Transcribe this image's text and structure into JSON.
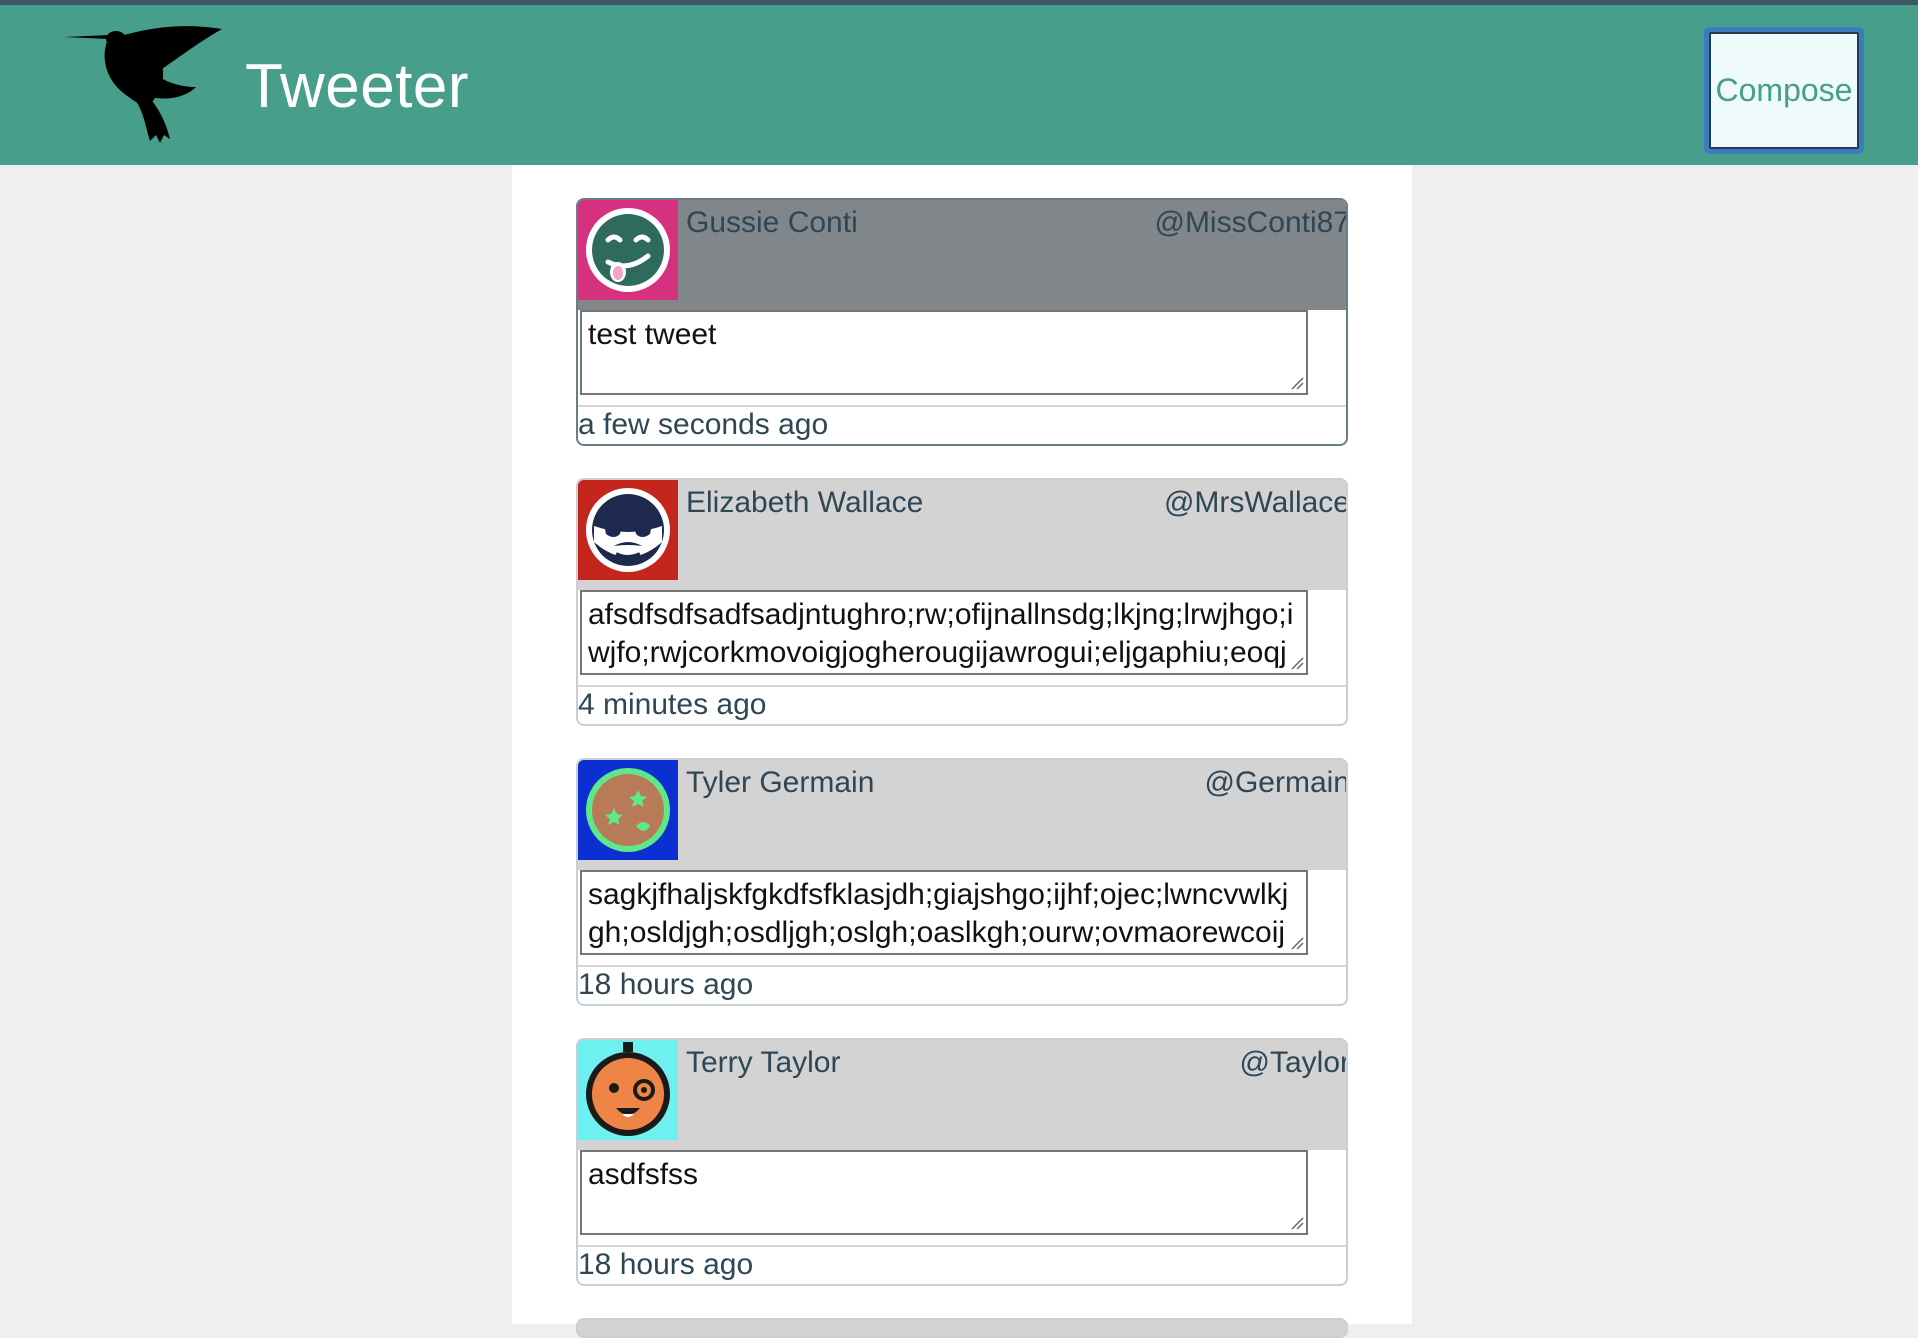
{
  "app": {
    "title": "Tweeter",
    "compose_label": "Compose",
    "colors": {
      "header": "#479e8a",
      "compose_text": "#479e8a",
      "compose_bg": "#effafa"
    }
  },
  "tweets": [
    {
      "name": "Gussie Conti",
      "handle": "@MissConti87",
      "text": "test tweet",
      "time": "a few seconds ago",
      "avatar": {
        "icon": "tongue-out-face-icon",
        "bg": "#d6317e",
        "face": "#2f6b5d"
      }
    },
    {
      "name": "Elizabeth Wallace",
      "handle": "@MrsWallace",
      "text": "afsdfsdfsadfsadjntughro;rw;ofijnallnsdg;lkjng;lrwjhgo;iwjfo;rwjcorkmovoigjogherougijawrogui;eljgaphiu;eoqjghilse",
      "time": "4 minutes ago",
      "avatar": {
        "icon": "sunglasses-mustache-face-icon",
        "bg": "#c4261d",
        "face": "#ffffff"
      }
    },
    {
      "name": "Tyler Germain",
      "handle": "@Germain",
      "text": "sagkjfhaljskfgkdfsfklasjdh;giajshgo;ijhf;ojec;lwncvwlkjgh;osldjgh;osdljgh;oslgh;oaslkgh;ourw;ovmaorewcoijwe;ow",
      "time": "18 hours ago",
      "avatar": {
        "icon": "star-eyes-face-icon",
        "bg": "#0b2fd0",
        "face": "#b97a57"
      }
    },
    {
      "name": "Terry Taylor",
      "handle": "@Taylor",
      "text": "asdfsfss",
      "time": "18 hours ago",
      "avatar": {
        "icon": "monocle-face-icon",
        "bg": "#6ff0f0",
        "face": "#ef8447"
      }
    }
  ]
}
